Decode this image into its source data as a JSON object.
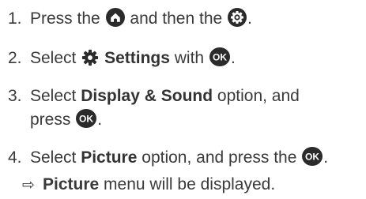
{
  "steps": [
    {
      "number": "1.",
      "text_a": "Press the",
      "text_b": "and then the",
      "text_c": ".",
      "icons": [
        "home-button-icon",
        "settings-button-icon"
      ]
    },
    {
      "number": "2.",
      "text_a": "Select",
      "bold": "Settings",
      "text_b": "with",
      "text_c": ".",
      "icons": [
        "gear-icon",
        "ok-button-icon"
      ]
    },
    {
      "number": "3.",
      "text_a": "Select",
      "bold": "Display & Sound",
      "text_b": "option, and",
      "line2_a": "press",
      "line2_c": ".",
      "icons": [
        "ok-button-icon"
      ]
    },
    {
      "number": "4.",
      "text_a": "Select",
      "bold": "Picture",
      "text_b": "option, and press the",
      "text_c": ".",
      "icons": [
        "ok-button-icon"
      ]
    }
  ],
  "result": {
    "arrow": "⇨",
    "bold": "Picture",
    "text": "menu will be displayed."
  }
}
